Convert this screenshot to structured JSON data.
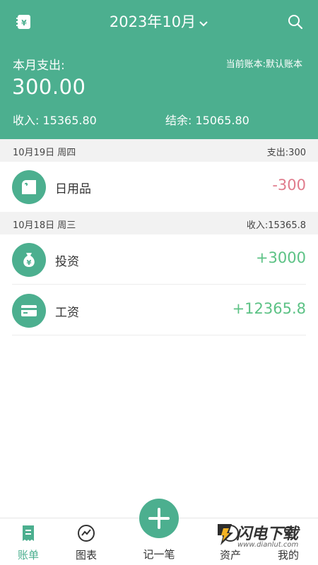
{
  "header": {
    "month": "2023年10月",
    "month_label": "本月支出:",
    "current_book": "当前账本:默认账本",
    "month_expense": "300.00",
    "income_label": "收入:",
    "income_value": "15365.80",
    "balance_label": "结余:",
    "balance_value": "15065.80",
    "accent_color": "#4caf8f"
  },
  "days": [
    {
      "date": "10月19日  周四",
      "summary": "支出:300",
      "entries": [
        {
          "name": "日用品",
          "amount": "-300",
          "icon": "toilet-paper-icon",
          "type": "expense"
        }
      ]
    },
    {
      "date": "10月18日  周三",
      "summary": "收入:15365.8",
      "entries": [
        {
          "name": "投资",
          "amount": "+3000",
          "icon": "money-bag-icon",
          "type": "income"
        },
        {
          "name": "工资",
          "amount": "+12365.8",
          "icon": "bank-card-icon",
          "type": "income"
        }
      ]
    }
  ],
  "tabbar": {
    "bills": "账单",
    "charts": "图表",
    "add": "记一笔",
    "assets": "资产",
    "mine": "我的"
  },
  "watermark": {
    "title": "闪电下载",
    "url": "www.dianlut.com"
  },
  "colors": {
    "expense": "#e07b8c",
    "income": "#5cc285"
  }
}
